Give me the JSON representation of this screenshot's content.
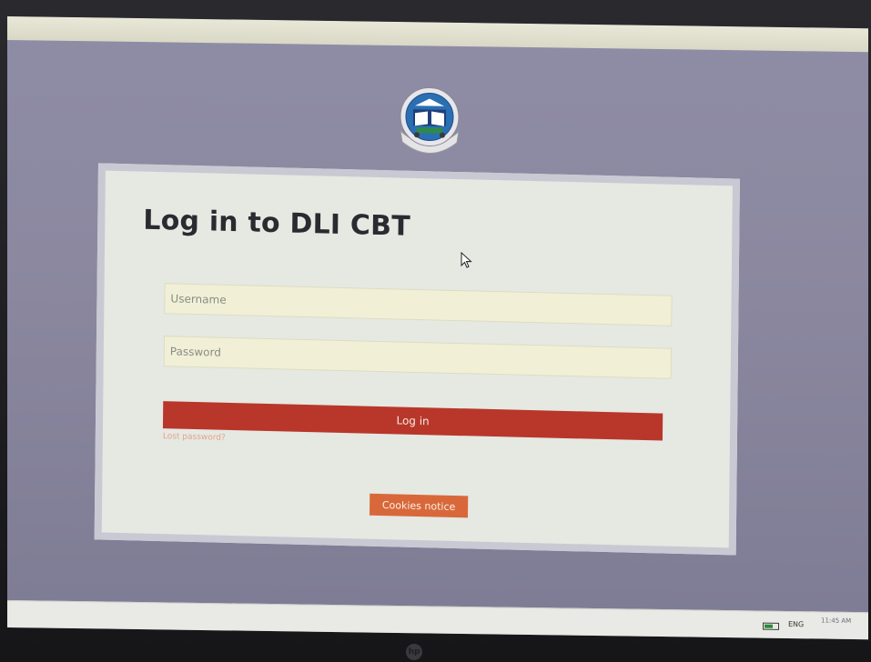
{
  "login": {
    "title": "Log in to DLI CBT",
    "username_placeholder": "Username",
    "password_placeholder": "Password",
    "login_label": "Log in",
    "lost_password": "Lost password?",
    "cookies_label": "Cookies notice"
  },
  "taskbar": {
    "language": "ENG",
    "time": "11:45 AM"
  },
  "colors": {
    "login_button": "#b8372a",
    "cookies_button": "#d8683a",
    "input_background": "#f1f0d6"
  }
}
